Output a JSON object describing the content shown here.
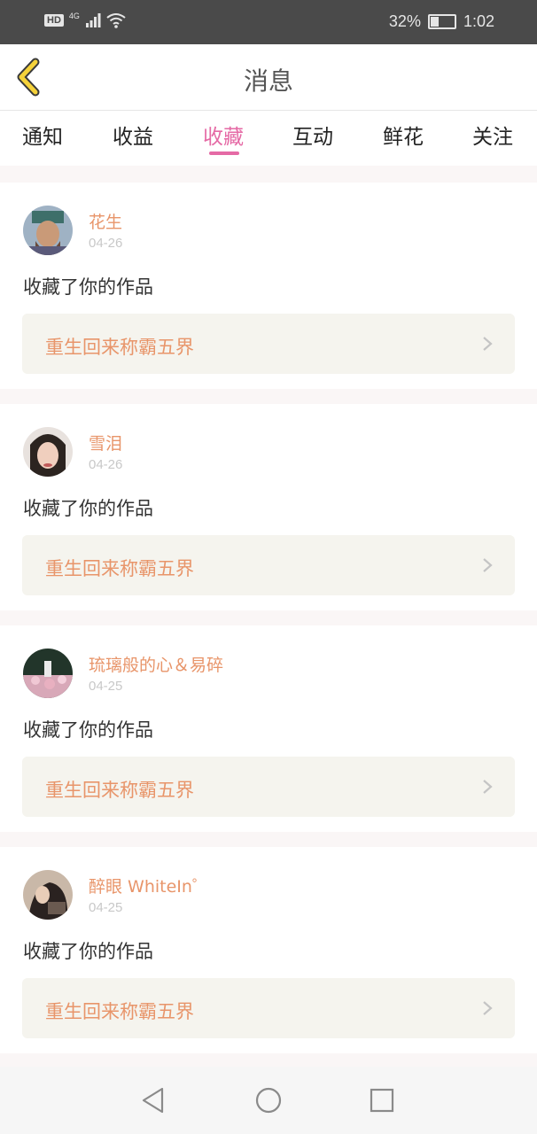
{
  "status_bar": {
    "hd": "HD",
    "network": "4G",
    "battery": "32%",
    "battery_level": 0.32,
    "time": "1:02"
  },
  "header": {
    "title": "消息"
  },
  "tabs": [
    {
      "label": "通知"
    },
    {
      "label": "收益"
    },
    {
      "label": "收藏"
    },
    {
      "label": "互动"
    },
    {
      "label": "鲜花"
    },
    {
      "label": "关注"
    }
  ],
  "active_tab": "收藏",
  "colors": {
    "accent": "#e56aa5",
    "username": "#e8956a",
    "work_title": "#e8956a",
    "work_bg": "#f5f4ee"
  },
  "messages": [
    {
      "username": "花生",
      "date": "04-26",
      "action": "收藏了你的作品",
      "work_title": "重生回来称霸五界"
    },
    {
      "username": "雪泪",
      "date": "04-26",
      "action": "收藏了你的作品",
      "work_title": "重生回来称霸五界"
    },
    {
      "username": "琉璃般的心＆易碎",
      "date": "04-25",
      "action": "收藏了你的作品",
      "work_title": "重生回来称霸五界"
    },
    {
      "username": "醉眼 WhiteIn゜",
      "date": "04-25",
      "action": "收藏了你的作品",
      "work_title": "重生回来称霸五界"
    }
  ],
  "nav": {
    "back": "back-triangle-icon",
    "home": "home-circle-icon",
    "recents": "recents-square-icon"
  }
}
